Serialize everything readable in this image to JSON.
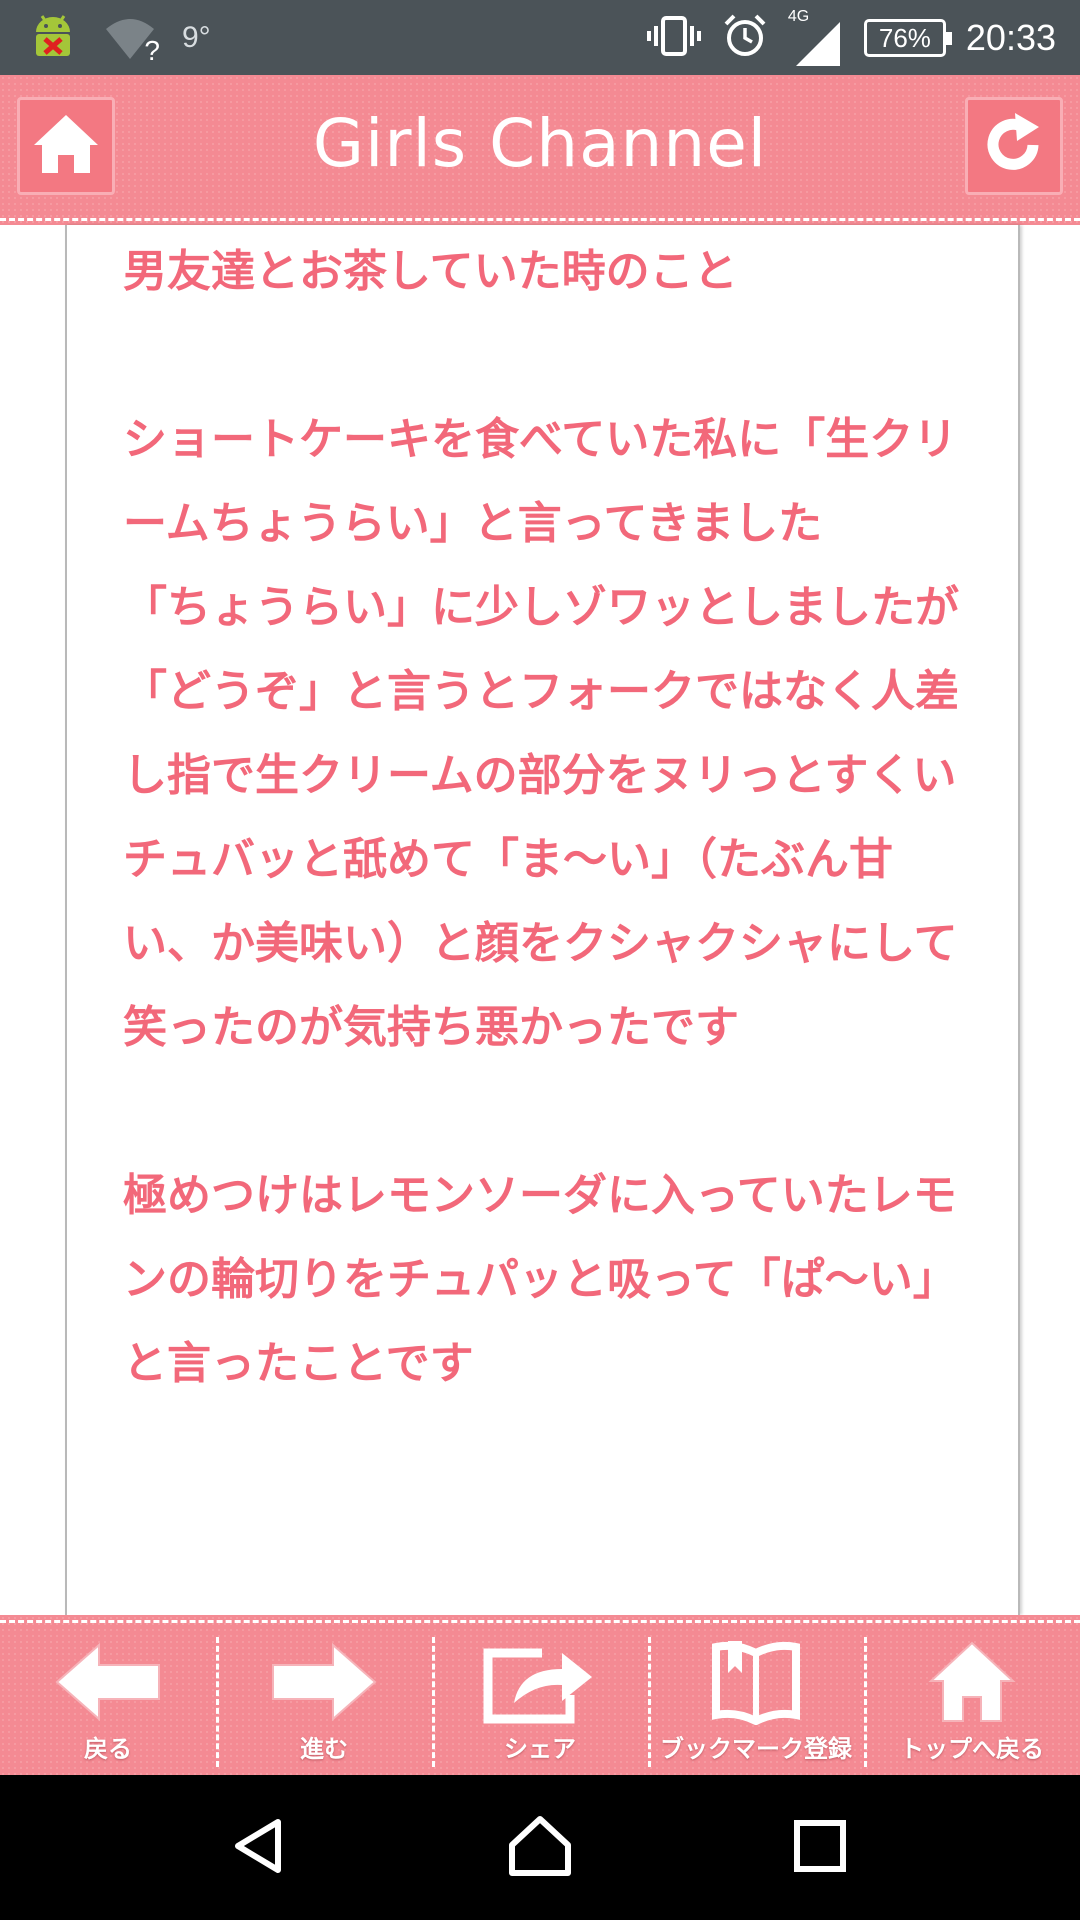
{
  "status_bar": {
    "signal_question": "?",
    "temperature": "9°",
    "network_type": "4G",
    "battery": "76%",
    "time": "20:33"
  },
  "header": {
    "title": "Girls Channel"
  },
  "comment": {
    "text": "男友達とお茶していた時のこと\n\nショートケーキを食べていた私に「生クリームちょうらい」と言ってきました\n「ちょうらい」に少しゾワッとしましたが「どうぞ」と言うとフォークではなく人差し指で生クリームの部分をヌリっとすくいチュバッと舐めて「ま〜い」（たぶん甘い、か美味い）と顔をクシャクシャにして笑ったのが気持ち悪かったです\n\n極めつけはレモンソーダに入っていたレモンの輪切りをチュパッと吸って「ぱ〜い」と言ったことです"
  },
  "toolbar": {
    "items": [
      {
        "label": "戻る",
        "icon": "arrow-left-icon"
      },
      {
        "label": "進む",
        "icon": "arrow-right-icon"
      },
      {
        "label": "シェア",
        "icon": "share-icon"
      },
      {
        "label": "ブックマーク登録",
        "icon": "bookmark-book-icon"
      },
      {
        "label": "トップへ戻る",
        "icon": "home-icon"
      }
    ]
  },
  "colors": {
    "accent_pink": "#f48a93",
    "text_pink": "#f2687a",
    "status_bar": "#4b5358"
  }
}
